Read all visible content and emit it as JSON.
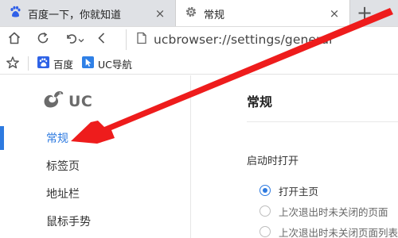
{
  "tabs": [
    {
      "title": "百度一下，你就知道",
      "icon": "baidu-paw-icon",
      "close": "×",
      "active": false
    },
    {
      "title": "常规",
      "icon": "gear-icon",
      "close": "×",
      "active": true
    }
  ],
  "new_tab_label": "+",
  "toolbar": {
    "url": "ucbrowser://settings/general",
    "icons": [
      "home-icon",
      "reload-icon",
      "undo-icon",
      "back-icon",
      "page-icon"
    ]
  },
  "bookmarks": {
    "items": [
      {
        "label": "百度",
        "icon": "baidu-paw-icon"
      },
      {
        "label": "UC导航",
        "icon": "uc-nav-icon"
      }
    ]
  },
  "sidebar": {
    "logo_text": "UC",
    "items": [
      {
        "label": "常规",
        "active": true
      },
      {
        "label": "标签页",
        "active": false
      },
      {
        "label": "地址栏",
        "active": false
      },
      {
        "label": "鼠标手势",
        "active": false
      }
    ]
  },
  "main": {
    "title": "常规",
    "startup": {
      "label": "启动时打开",
      "options": [
        {
          "label": "打开主页",
          "checked": true
        },
        {
          "label": "上次退出时未关闭的页面",
          "checked": false
        },
        {
          "label": "上次退出时未关闭页面列表页",
          "checked": false
        }
      ]
    }
  },
  "colors": {
    "accent": "#2d7ae0",
    "annotation_arrow": "#ee1c1c",
    "inactive_tab": "#dfe1e5"
  }
}
